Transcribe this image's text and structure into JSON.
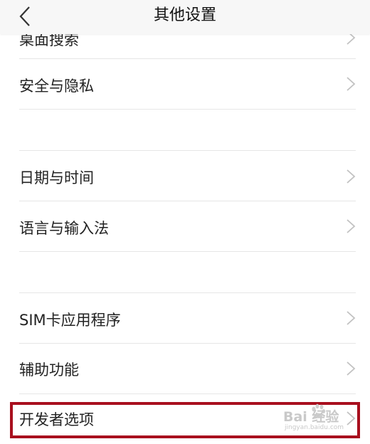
{
  "header": {
    "title": "其他设置"
  },
  "settings": {
    "items": [
      {
        "label": "桌面搜索"
      },
      {
        "label": "安全与隐私"
      },
      {
        "label": "日期与时间"
      },
      {
        "label": "语言与输入法"
      },
      {
        "label": "SIM卡应用程序"
      },
      {
        "label": "辅助功能"
      },
      {
        "label": "开发者选项"
      }
    ]
  },
  "watermark": {
    "main": "Bai 经验",
    "sub": "jingyan.baidu.com"
  },
  "colors": {
    "highlight": "#a80f1e",
    "header_bg": "#f7f7f7",
    "divider": "#e6e6e6",
    "chevron": "#c2c2c2"
  },
  "icons": [
    "back-arrow-icon",
    "chevron-right-icon",
    "baidu-paw-icon"
  ]
}
